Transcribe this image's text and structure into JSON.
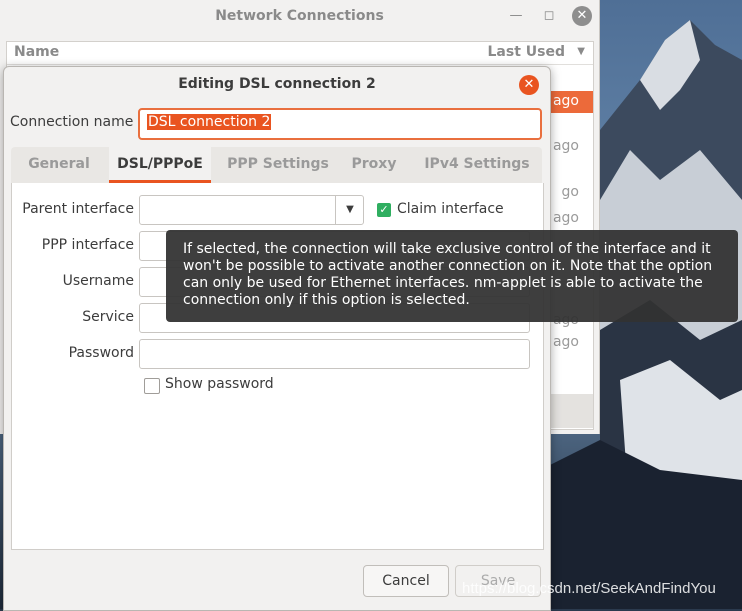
{
  "network_connections": {
    "title": "Network Connections",
    "column_name": "Name",
    "column_last_used": "Last Used",
    "row_fragments": [
      "e ago",
      "es ago",
      "go",
      "ago",
      "ago",
      "ago"
    ]
  },
  "dialog": {
    "title": "Editing DSL connection 2",
    "connection_name_label": "Connection name",
    "connection_name_value": "DSL connection 2",
    "tabs": [
      "General",
      "DSL/PPPoE",
      "PPP Settings",
      "Proxy",
      "IPv4 Settings"
    ],
    "active_tab": "DSL/PPPoE",
    "fields": {
      "parent_interface": "Parent interface",
      "ppp_interface": "PPP interface",
      "username": "Username",
      "service": "Service",
      "password": "Password"
    },
    "claim_interface_label": "Claim interface",
    "claim_interface_checked": true,
    "show_password_label": "Show password",
    "show_password_checked": false,
    "cancel_label": "Cancel",
    "save_label": "Save"
  },
  "tooltip": {
    "text": "If selected, the connection will take exclusive control of the interface and it won't be possible to activate another connection on it. Note that the option can only be used for Ethernet interfaces. nm-applet is able to activate the connection only if this option is selected."
  },
  "watermark": "https://blog.csdn.net/SeekAndFindYou",
  "colors": {
    "accent": "#e95420",
    "check": "#2fae60",
    "tooltip_bg": "#323232"
  }
}
